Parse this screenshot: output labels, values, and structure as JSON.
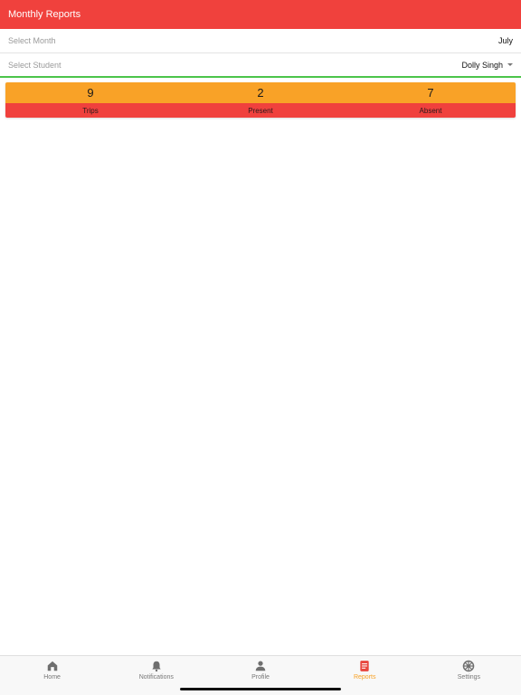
{
  "header": {
    "title": "Monthly Reports"
  },
  "filters": {
    "month_label": "Select Month",
    "month_value": "July",
    "student_label": "Select Student",
    "student_value": "Dolly Singh"
  },
  "stats": [
    {
      "value": "9",
      "label": "Trips"
    },
    {
      "value": "2",
      "label": "Present"
    },
    {
      "value": "7",
      "label": "Absent"
    }
  ],
  "tabs": [
    {
      "label": "Home",
      "icon": "home-icon"
    },
    {
      "label": "Notifications",
      "icon": "bell-icon"
    },
    {
      "label": "Profile",
      "icon": "person-icon"
    },
    {
      "label": "Reports",
      "icon": "report-icon",
      "active": true
    },
    {
      "label": "Settings",
      "icon": "settings-icon"
    }
  ],
  "colors": {
    "header": "#f0413d",
    "stats_top": "#f9a227",
    "stats_bottom": "#f0413d",
    "accent_active": "#f7a125",
    "divider_green": "#4cc54a"
  }
}
